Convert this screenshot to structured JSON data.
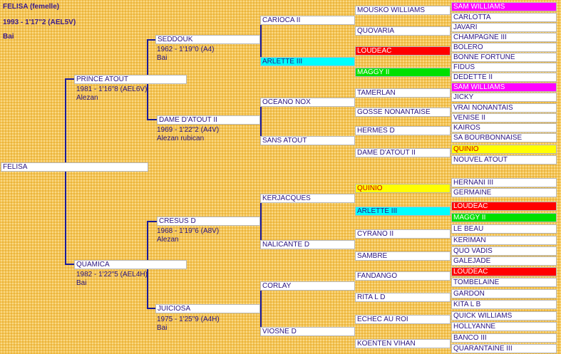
{
  "header": {
    "title": "FELISA  (femelle)",
    "record": "1993 -  1'17\"2 (AEL5V)",
    "color": "Bai"
  },
  "gen0": {
    "name": "FELISA"
  },
  "gen1": [
    {
      "name": "PRINCE ATOUT",
      "record": "1981 -  1'16\"8 (AEL6V)",
      "color": "Alezan"
    },
    {
      "name": "QUAMICA",
      "record": "1982 -  1'22\"5 (AEL4H)",
      "color": "Bai"
    }
  ],
  "gen2": [
    {
      "name": "SEDDOUK",
      "record": "1962 -  1'19\"0 (A4)",
      "color": "Bai"
    },
    {
      "name": "DAME D'ATOUT II",
      "record": "1969 -  1'22\"2 (A4V)",
      "color": "Alezan rubican"
    },
    {
      "name": "CRESUS D",
      "record": "1968 -  1'19\"6 (A8V)",
      "color": "Alezan"
    },
    {
      "name": "JUICIOSA",
      "record": "1975 -  1'25\"9 (A4H)",
      "color": "Bai"
    }
  ],
  "gen3": [
    "CARIOCA II",
    "ARLETTE III",
    "OCEANO NOX",
    "SANS ATOUT",
    "KERJACQUES",
    "NALICANTE D",
    "CORLAY",
    "VIOSNE D"
  ],
  "gen4": [
    "MOUSKO WILLIAMS",
    "QUOVARIA",
    "LOUDEAC",
    "MAGGY II",
    "TAMERLAN",
    "GOSSE NONANTAISE",
    "HERMES D",
    "DAME D'ATOUT II",
    "QUINIO",
    "ARLETTE III",
    "CYRANO II",
    "SAMBRE",
    "FANDANGO",
    "RITA L D",
    "ECHEC AU ROI",
    "KOENTEN VIHAN"
  ],
  "gen5": [
    "SAM WILLIAMS",
    "CARLOTTA",
    "JAVARI",
    "CHAMPAGNE III",
    "BOLERO",
    "BONNE FORTUNE",
    "FIDUS",
    "DEDETTE II",
    "SAM WILLIAMS",
    "JICKY",
    "VRAI NONANTAIS",
    "VENISE II",
    "KAIROS",
    "SA BOURBONNAISE",
    "QUINIO",
    "NOUVEL ATOUT",
    "HERNANI III",
    "GERMAINE",
    "LOUDEAC",
    "MAGGY II",
    "LE BEAU",
    "KERIMAN",
    "QUO VADIS",
    "GALEJADE",
    "LOUDEAC",
    "TOMBELAINE",
    "GARDON",
    "KITA L B",
    "QUICK WILLIAMS",
    "HOLLYANNE",
    "BANCO III",
    "QUARANTAINE III"
  ],
  "highlight_colors": {
    "magenta": "#ff00ff",
    "red": "#ff0000",
    "green": "#00e000",
    "cyan": "#00ffff",
    "yellow": "#ffff00"
  }
}
